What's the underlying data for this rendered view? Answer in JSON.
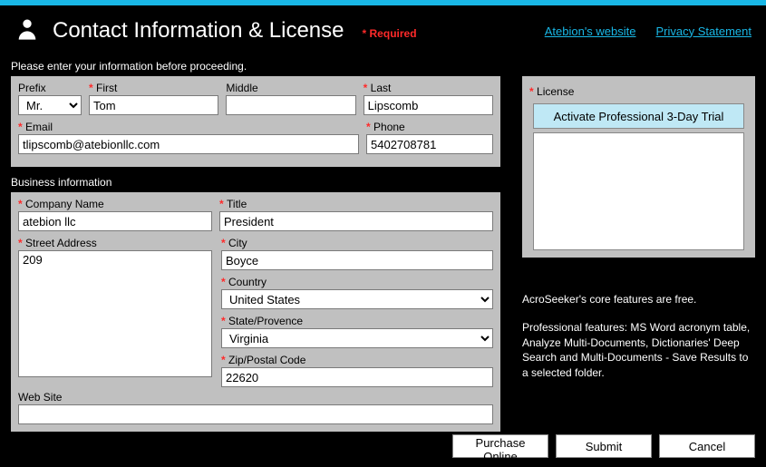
{
  "header": {
    "title": "Contact Information & License",
    "required_note": "* Required",
    "link_website": "Atebion's website",
    "link_privacy": "Privacy Statement"
  },
  "subhead": "Please enter your information before proceeding.",
  "personal": {
    "prefix_label": "Prefix",
    "prefix_value": "Mr.",
    "first_label": "First",
    "first_value": "Tom",
    "middle_label": "Middle",
    "middle_value": "",
    "last_label": "Last",
    "last_value": "Lipscomb",
    "email_label": "Email",
    "email_value": "tlipscomb@atebionllc.com",
    "phone_label": "Phone",
    "phone_value": "5402708781"
  },
  "business_section": "Business information",
  "business": {
    "company_label": "Company Name",
    "company_value": "atebion llc",
    "title_label": "Title",
    "title_value": "President",
    "street_label": "Street Address",
    "street_value": "209",
    "city_label": "City",
    "city_value": "Boyce",
    "country_label": "Country",
    "country_value": "United States",
    "state_label": "State/Provence",
    "state_value": "Virginia",
    "zip_label": "Zip/Postal Code",
    "zip_value": "22620",
    "website_label": "Web Site",
    "website_value": ""
  },
  "license": {
    "label": "License",
    "button": "Activate Professional  3-Day Trial"
  },
  "blurb": {
    "p1": "AcroSeeker's core features are free.",
    "p2": "Professional features: MS Word acronym table, Analyze Multi-Documents, Dictionaries' Deep Search and Multi-Documents - Save Results to a selected folder."
  },
  "footer": {
    "purchase": "Purchase Online",
    "submit": "Submit",
    "cancel": "Cancel"
  }
}
